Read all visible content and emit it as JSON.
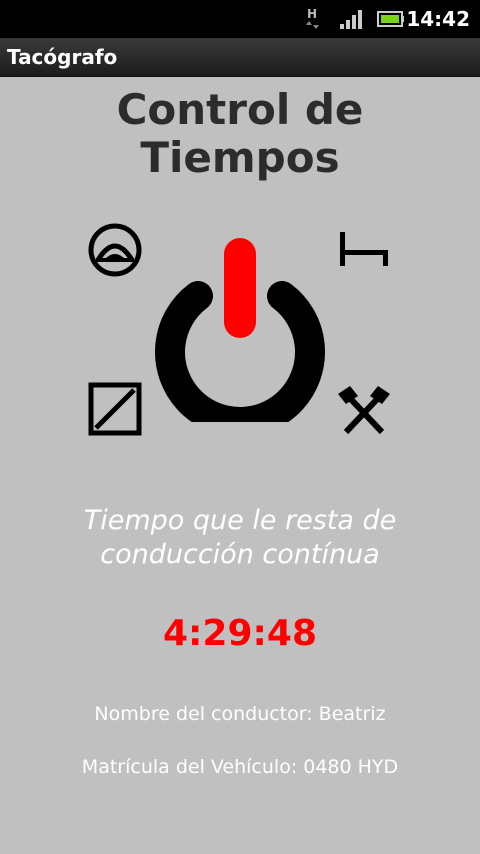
{
  "status_bar": {
    "network_type": "H",
    "time": "14:42"
  },
  "app": {
    "title": "Tacógrafo"
  },
  "header": {
    "title_line1": "Control de",
    "title_line2": "Tiempos"
  },
  "activities": {
    "top_left_icon": "availability-icon",
    "top_right_icon": "rest-bed-icon",
    "bottom_left_icon": "other-work-icon",
    "bottom_right_icon": "work-hammers-icon",
    "center_icon": "power-icon"
  },
  "remaining": {
    "label_line1": "Tiempo que le resta de",
    "label_line2": "conducción contínua",
    "value": "4:29:48"
  },
  "driver": {
    "text": "Nombre del conductor: Beatriz"
  },
  "vehicle": {
    "text": "Matrícula del Vehículo: 0480 HYD"
  },
  "colors": {
    "background": "#c0c0c0",
    "timer": "#ff0000",
    "power_indicator": "#ff0000",
    "title_text": "#2c2c2c"
  }
}
